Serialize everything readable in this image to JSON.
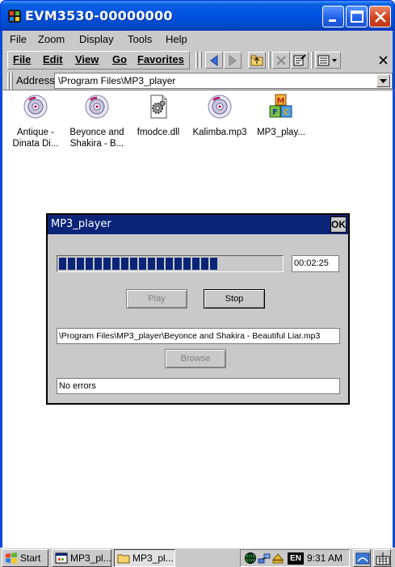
{
  "window": {
    "title": "EVM3530-00000000",
    "app_icon": "windows-device-icon"
  },
  "menubar": {
    "items": [
      "File",
      "Zoom",
      "Display",
      "Tools",
      "Help"
    ]
  },
  "toolbar": {
    "menus": [
      "File",
      "Edit",
      "View",
      "Go",
      "Favorites"
    ],
    "buttons": [
      "back-icon",
      "forward-icon",
      "up-folder-icon",
      "delete-icon",
      "properties-icon",
      "views-icon",
      "close-icon"
    ]
  },
  "addressbar": {
    "label": "Address",
    "value": "\\Program Files\\MP3_player"
  },
  "files": [
    {
      "label": "Antique -\nDinata Di...",
      "icon": "music-cd-icon"
    },
    {
      "label": "Beyonce and\nShakira - B...",
      "icon": "music-cd-icon"
    },
    {
      "label": "fmodce.dll",
      "icon": "dll-gear-icon"
    },
    {
      "label": "Kalimba.mp3",
      "icon": "music-cd-icon"
    },
    {
      "label": "MP3_play...",
      "icon": "mfc-blocks-icon"
    }
  ],
  "dialog": {
    "title": "MP3_player",
    "ok_label": "OK",
    "progress": 0.72,
    "time": "00:02:25",
    "play_label": "Play",
    "stop_label": "Stop",
    "path": "\\Program Files\\MP3_player\\Beyonce and Shakira - Beautiful Liar.mp3",
    "browse_label": "Browse",
    "status": "No errors"
  },
  "taskbar": {
    "start_label": "Start",
    "tasks": [
      {
        "label": "MP3_pl...",
        "icon": "app-window-icon",
        "active": false
      },
      {
        "label": "MP3_pl...",
        "icon": "folder-icon",
        "active": true
      }
    ],
    "tray_icons": [
      "network-icon",
      "connectivity-icon",
      "eject-icon",
      "language-icon"
    ],
    "language": "EN",
    "clock": "9:31 AM"
  },
  "colors": {
    "title_blue": "#0053e1",
    "dialog_title": "#0a2478",
    "progress_fill": "#0a2478",
    "chrome_gray": "#c9c9c9"
  }
}
